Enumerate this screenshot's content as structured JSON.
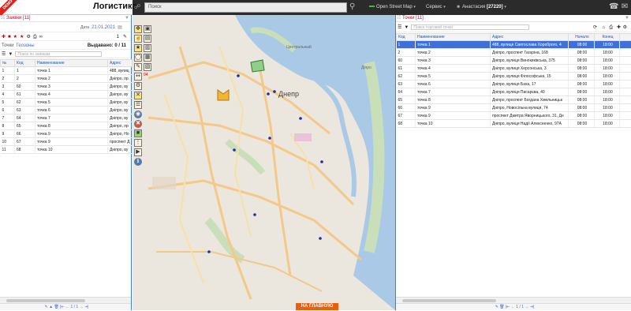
{
  "app": {
    "title": "Логистика",
    "ribbon": "DEMO",
    "search_placeholder": "Поиск",
    "map_provider": "Open Street Map",
    "service_menu": "Сервис",
    "user_name": "Анастасия",
    "user_balance": "[27220]"
  },
  "left": {
    "title": "Заявки [11]",
    "date_label": "Дата",
    "date_value": "21.01.2021",
    "page_num": "1",
    "tabs": [
      "Точки",
      "Геозоны"
    ],
    "issued": "Выдавано: 0 / 11",
    "filter_placeholder": "Поиск по заявкам",
    "columns": [
      "№",
      "Код",
      "Наименование",
      "Адрес"
    ],
    "rows": [
      [
        "1",
        "1",
        "точка 1",
        "488, вулиц"
      ],
      [
        "2",
        "2",
        "точка 2",
        "Дніпро, пр"
      ],
      [
        "3",
        "60",
        "точка 3",
        "Дніпро, ву"
      ],
      [
        "4",
        "61",
        "точка 4",
        "Дніпро, ву"
      ],
      [
        "5",
        "62",
        "точка 5",
        "Дніпро, ву"
      ],
      [
        "6",
        "63",
        "точка 6",
        "Дніпро, ву"
      ],
      [
        "7",
        "64",
        "точка 7",
        "Дніпро, ву"
      ],
      [
        "8",
        "65",
        "точка 8",
        "Дніпро, пр"
      ],
      [
        "9",
        "66",
        "точка 9",
        "Дніпро, Но"
      ],
      [
        "10",
        "67",
        "точка 9",
        "проспект Д"
      ],
      [
        "11",
        "68",
        "точка 10",
        "Дніпро, ву"
      ]
    ],
    "pager": "1 / 1"
  },
  "map": {
    "city_label": "Днепр",
    "labels": [
      "Центральный",
      "Діпро"
    ],
    "home_button": "НА ГЛАВНУЮ",
    "tool_badge": "04",
    "tool_badge2": "0"
  },
  "right": {
    "title": "Точки [11]",
    "filter_placeholder": "Поиск торговой точки",
    "columns": [
      "Код",
      "Наименование",
      "Адрес",
      "Начало",
      "Конец"
    ],
    "rows": [
      [
        "1",
        "точка 1",
        "488, вулиця Святослава Хороброго, 4",
        "08:00",
        "18:00"
      ],
      [
        "2",
        "точка 2",
        "Дніпро, проспект Гагаріна, 168",
        "08:00",
        "18:00"
      ],
      [
        "60",
        "точка 3",
        "Дніпро, вулиця Винокиківська, 375",
        "08:00",
        "18:00"
      ],
      [
        "61",
        "точка 4",
        "Дніпро, вулиця Херсонська, 3",
        "08:00",
        "18:00"
      ],
      [
        "62",
        "точка 5",
        "Дніпро, вулиця Філософська, 15",
        "08:00",
        "18:00"
      ],
      [
        "63",
        "точка 6",
        "Дніпро, вулиця Баха, 17",
        "08:00",
        "18:00"
      ],
      [
        "64",
        "точка 7",
        "Дніпро, вулиця Писарєва, 40",
        "08:00",
        "18:00"
      ],
      [
        "65",
        "точка 8",
        "Дніпро, проспект Богдана Хмельницьк",
        "08:00",
        "18:00"
      ],
      [
        "66",
        "точка 9",
        "Дніпро, Новосільна вулиця, 74",
        "08:00",
        "18:00"
      ],
      [
        "67",
        "точка 9",
        "проспект Дмитра Яворницького, 31, Дн",
        "08:00",
        "18:00"
      ],
      [
        "68",
        "точка 10",
        "Дніпро, вулиця Надії Алексеенко, 97А",
        "08:00",
        "18:00"
      ]
    ],
    "pager": "1 / 1"
  }
}
